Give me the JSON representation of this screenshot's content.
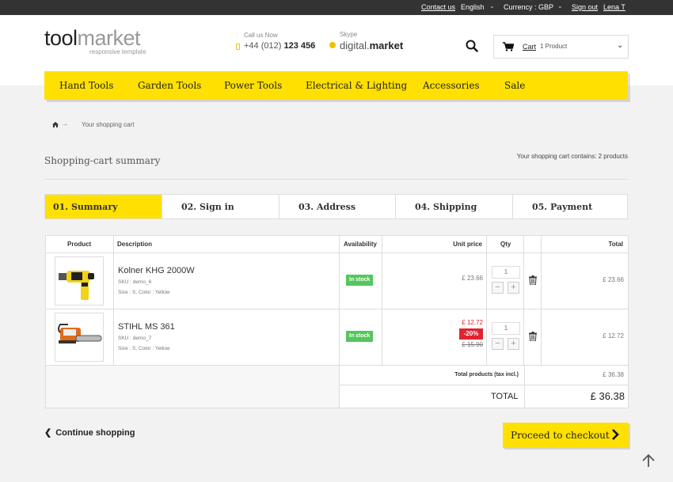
{
  "topbar": {
    "contact": "Contact us",
    "language": "English",
    "currency": "Currency : GBP",
    "signout": "Sign out",
    "user": "Lena T"
  },
  "header": {
    "logo_part1": "tool",
    "logo_part2": "market",
    "logo_tagline": "responsive template",
    "call_label": "Call us Now",
    "call_prefix": "+44 (012)",
    "call_number": "123 456",
    "skype_label": "Skype",
    "skype_prefix": "digital.",
    "skype_name": "market",
    "cart_label": "Cart",
    "cart_count": "1 Product"
  },
  "nav": {
    "items": [
      "Hand Tools",
      "Garden Tools",
      "Power Tools",
      "Electrical & Lighting",
      "Accessories",
      "Sale"
    ]
  },
  "breadcrumb": {
    "current": "Your shopping cart"
  },
  "page": {
    "title": "Shopping-cart summary",
    "contains": "Your shopping cart contains: 2 products"
  },
  "steps": [
    "01. Summary",
    "02. Sign in",
    "03. Address",
    "04. Shipping",
    "05. Payment"
  ],
  "table": {
    "headers": {
      "product": "Product",
      "description": "Description",
      "availability": "Availability",
      "unit_price": "Unit price",
      "qty": "Qty",
      "total": "Total"
    },
    "rows": [
      {
        "name": "Kolner KHG 2000W",
        "sku": "SKU : demo_6",
        "attrs": "Size : S, Color : Yellow",
        "stock": "In stock",
        "price": "£ 23.66",
        "qty": "1",
        "total": "£ 23.66"
      },
      {
        "name": "STIHL MS 361",
        "sku": "SKU : demo_7",
        "attrs": "Size : S, Color : Yellow",
        "stock": "In stock",
        "price": "£ 12.72",
        "discount": "-20%",
        "old_price": "£ 15.90",
        "qty": "1",
        "total": "£ 12.72"
      }
    ],
    "total_products_label": "Total products (tax incl.)",
    "total_products_value": "£ 36.38",
    "total_label": "TOTAL",
    "total_value": "£ 36.38"
  },
  "actions": {
    "continue": "Continue shopping",
    "checkout": "Proceed to checkout"
  },
  "colors": {
    "accent": "#ffe000",
    "stock": "#55c65e",
    "sale": "#e0242f"
  }
}
